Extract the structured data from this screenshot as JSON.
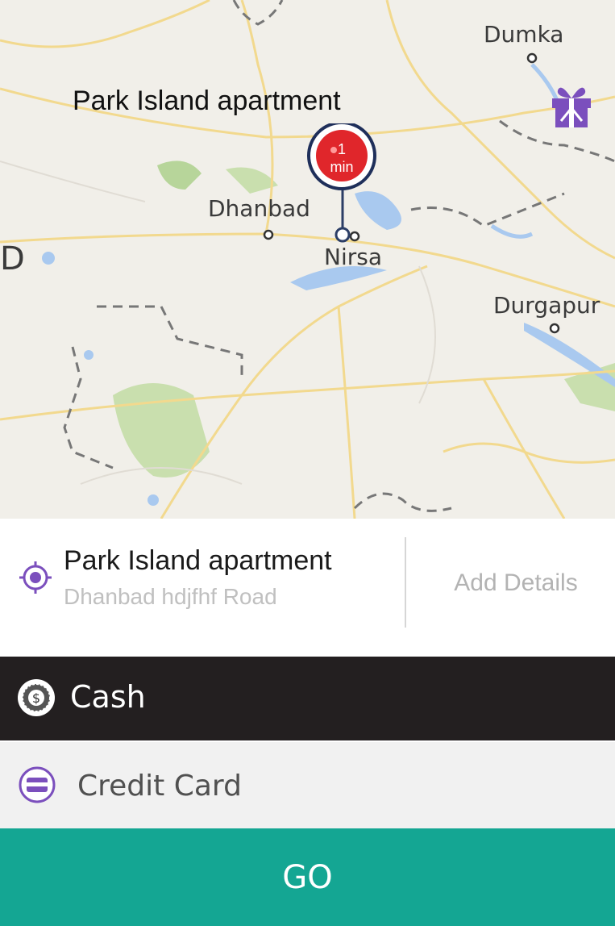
{
  "map": {
    "pin_title": "Park Island apartment",
    "eta_value": "1",
    "eta_unit": "min",
    "places": [
      "Dumka",
      "Dhanbad",
      "Nirsa",
      "Durgapur",
      "D"
    ]
  },
  "address": {
    "title": "Park Island apartment",
    "subtitle": "Dhanbad hdjfhf Road",
    "add_details": "Add Details"
  },
  "payment": {
    "cash_label": "Cash",
    "credit_card_label": "Credit Card"
  },
  "go_label": "GO",
  "colors": {
    "accent_purple": "#7b4fbd",
    "go_green": "#14a693",
    "pin_red": "#e0262b",
    "cash_bg": "#231f20"
  },
  "icons": {
    "gift": "gift-icon",
    "location": "location-target-icon",
    "cash": "cash-icon",
    "card": "credit-card-icon"
  }
}
